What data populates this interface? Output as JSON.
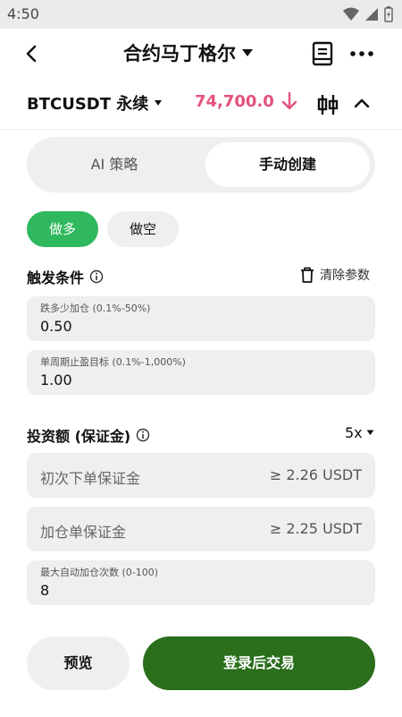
{
  "status_bar": {
    "time": "4:50",
    "icons": [
      "wifi-icon",
      "signal-icon",
      "battery-icon"
    ]
  },
  "header": {
    "title": "合约马丁格尔",
    "icons": [
      "back-icon",
      "caret-down-icon",
      "document-icon",
      "more-icon"
    ]
  },
  "pair": {
    "name": "BTCUSDT 永续",
    "price": "74,700.0",
    "price_direction": "down",
    "price_color": "#e4517b"
  },
  "mode_tabs": [
    {
      "label": "AI 策略",
      "active": false
    },
    {
      "label": "手动创建",
      "active": true
    }
  ],
  "direction": {
    "long_label": "做多",
    "short_label": "做空",
    "selected": "long",
    "long_color": "#2fb85e"
  },
  "trigger": {
    "title": "触发条件",
    "clear_label": "清除参数",
    "fields": [
      {
        "label": "跌多少加仓 (0.1%-50%)",
        "value": "0.50"
      },
      {
        "label": "单周期止盈目标 (0.1%-1,000%)",
        "value": "1.00"
      }
    ]
  },
  "investment": {
    "title": "投资额 (保证金)",
    "leverage": "5x",
    "initial_margin": {
      "placeholder": "初次下单保证金",
      "hint": "≥ 2.26 USDT"
    },
    "add_margin": {
      "placeholder": "加仓单保证金",
      "hint": "≥ 2.25 USDT"
    },
    "max_adds": {
      "label": "最大自动加仓次数 (0-100)",
      "value": "8"
    }
  },
  "footer": {
    "preview_label": "预览",
    "login_trade_label": "登录后交易",
    "login_color": "#2b6e1c"
  }
}
